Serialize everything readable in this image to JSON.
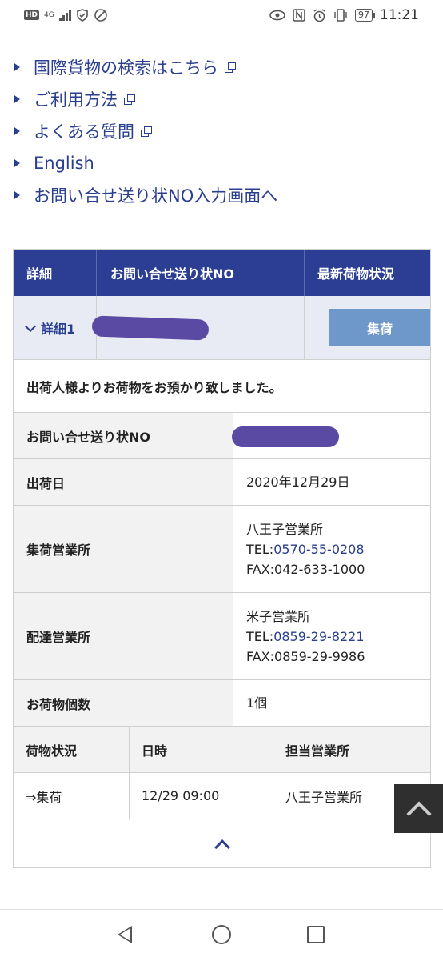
{
  "status_bar": {
    "hd": "HD",
    "network": "4G",
    "time": "11:21",
    "battery": "97",
    "icons": [
      "eye-icon",
      "nfc-icon",
      "alarm-icon",
      "vibrate-icon"
    ]
  },
  "links": [
    {
      "label": "国際貨物の検索はこちら",
      "external": true
    },
    {
      "label": "ご利用方法",
      "external": true
    },
    {
      "label": "よくある質問",
      "external": true
    },
    {
      "label": "English",
      "external": false
    },
    {
      "label": "お問い合せ送り状NO入力画面へ",
      "external": false
    }
  ],
  "table": {
    "headers": [
      "詳細",
      "お問い合せ送り状NO",
      "最新荷物状況"
    ],
    "detail_label": "詳細1",
    "status_button": "集荷",
    "message": "出荷人様よりお荷物をお預かり致しました。",
    "info": {
      "tracking_label": "お問い合せ送り状NO",
      "ship_date_label": "出荷日",
      "ship_date": "2020年12月29日",
      "pickup_office_label": "集荷営業所",
      "pickup_office_name": "八王子営業所",
      "pickup_tel_prefix": "TEL:",
      "pickup_tel": "0570-55-0208",
      "pickup_fax": "FAX:042-633-1000",
      "delivery_office_label": "配達営業所",
      "delivery_office_name": "米子営業所",
      "delivery_tel_prefix": "TEL:",
      "delivery_tel": "0859-29-8221",
      "delivery_fax": "FAX:0859-29-9986",
      "count_label": "お荷物個数",
      "count": "1個"
    },
    "history": {
      "headers": [
        "荷物状況",
        "日時",
        "担当営業所"
      ],
      "rows": [
        {
          "status": "⇒集荷",
          "datetime": "12/29 09:00",
          "office": "八王子営業所"
        }
      ]
    }
  },
  "colors": {
    "accent": "#2c3e94",
    "status_button": "#6e98c9",
    "link": "#2a3e8f",
    "redaction": "#5b4aa3"
  }
}
